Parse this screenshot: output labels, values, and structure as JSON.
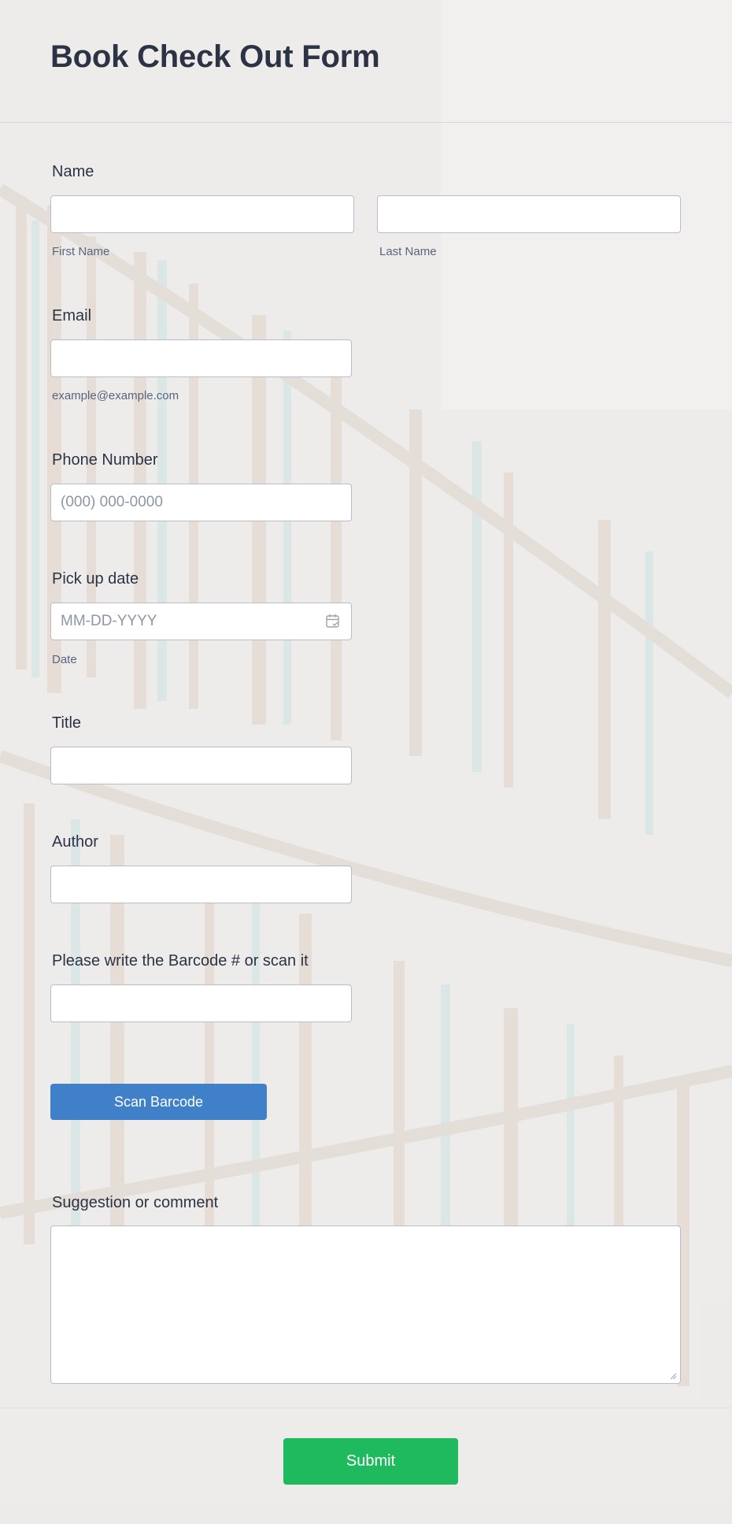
{
  "form": {
    "title": "Book Check Out Form"
  },
  "name": {
    "label": "Name",
    "first_sublabel": "First Name",
    "last_sublabel": "Last Name",
    "first_value": "",
    "last_value": ""
  },
  "email": {
    "label": "Email",
    "value": "",
    "sublabel": "example@example.com"
  },
  "phone": {
    "label": "Phone Number",
    "placeholder": "(000) 000-0000"
  },
  "pickup": {
    "label": "Pick up date",
    "placeholder": "MM-DD-YYYY",
    "sublabel": "Date",
    "icon": "calendar-icon"
  },
  "title_field": {
    "label": "Title",
    "value": ""
  },
  "author": {
    "label": "Author",
    "value": ""
  },
  "barcode": {
    "label": "Please write the Barcode # or scan it",
    "value": "",
    "scan_button": "Scan Barcode"
  },
  "comment": {
    "label": "Suggestion or comment",
    "value": ""
  },
  "submit": {
    "label": "Submit"
  },
  "colors": {
    "scan_button": "#3f80c9",
    "submit_button": "#1fba5e",
    "text": "#2c3345",
    "sublabel": "#57647e"
  }
}
